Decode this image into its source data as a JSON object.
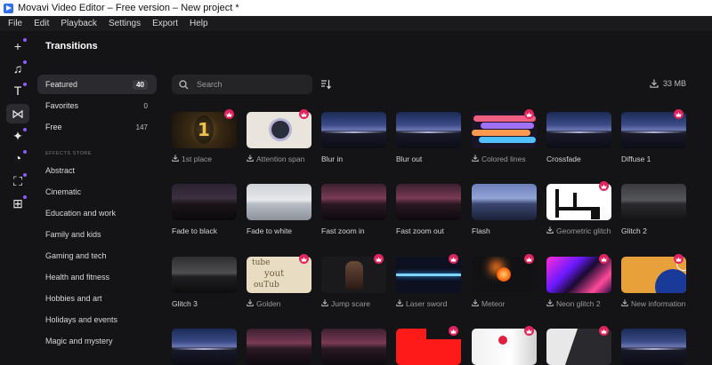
{
  "window": {
    "title": "Movavi Video Editor – Free version – New project *"
  },
  "menu": [
    "File",
    "Edit",
    "Playback",
    "Settings",
    "Export",
    "Help"
  ],
  "tools": [
    {
      "icon": "plus-icon",
      "glyph": "+"
    },
    {
      "icon": "music-icon",
      "glyph": "♫"
    },
    {
      "icon": "text-icon",
      "glyph": "T"
    },
    {
      "icon": "transitions-icon",
      "glyph": "⋈"
    },
    {
      "icon": "sparkle-icon",
      "glyph": "✦"
    },
    {
      "icon": "sticker-icon",
      "glyph": "◔"
    },
    {
      "icon": "store-icon",
      "glyph": "⛶"
    },
    {
      "icon": "more-tools-icon",
      "glyph": "⊞"
    }
  ],
  "panel": {
    "title": "Transitions"
  },
  "categories": [
    {
      "label": "Featured",
      "count": "40",
      "selected": true
    },
    {
      "label": "Favorites",
      "count": "0",
      "selected": false
    },
    {
      "label": "Free",
      "count": "147",
      "selected": false
    }
  ],
  "store": {
    "label": "EFFECTS STORE",
    "items": [
      "Abstract",
      "Cinematic",
      "Education and work",
      "Family and kids",
      "Gaming and tech",
      "Health and fitness",
      "Hobbies and art",
      "Holidays and events",
      "Magic and mystery"
    ]
  },
  "search": {
    "placeholder": "Search"
  },
  "storage": {
    "size": "33 MB"
  },
  "tiles": [
    {
      "label": "1st place",
      "download": true,
      "premium": true,
      "thumb": "place"
    },
    {
      "label": "Attention span",
      "download": true,
      "premium": true,
      "thumb": "attn"
    },
    {
      "label": "Blur in",
      "download": false,
      "premium": false,
      "thumb": "bridge"
    },
    {
      "label": "Blur out",
      "download": false,
      "premium": false,
      "thumb": "bridge"
    },
    {
      "label": "Colored lines",
      "download": true,
      "premium": true,
      "thumb": "lines"
    },
    {
      "label": "Crossfade",
      "download": false,
      "premium": false,
      "thumb": "bridge"
    },
    {
      "label": "Diffuse 1",
      "download": false,
      "premium": true,
      "thumb": "bridge"
    },
    {
      "label": "Fade to black",
      "download": false,
      "premium": false,
      "thumb": "dark"
    },
    {
      "label": "Fade to white",
      "download": false,
      "premium": false,
      "thumb": "white"
    },
    {
      "label": "Fast zoom in",
      "download": false,
      "premium": false,
      "thumb": "pink"
    },
    {
      "label": "Fast zoom out",
      "download": false,
      "premium": false,
      "thumb": "pink"
    },
    {
      "label": "Flash",
      "download": false,
      "premium": false,
      "thumb": "flash"
    },
    {
      "label": "Geometric glitch",
      "download": true,
      "premium": true,
      "thumb": "geo"
    },
    {
      "label": "Glitch 2",
      "download": false,
      "premium": false,
      "thumb": "gray"
    },
    {
      "label": "Glitch 3",
      "download": false,
      "premium": false,
      "thumb": "bw"
    },
    {
      "label": "Golden",
      "download": true,
      "premium": true,
      "thumb": "golden"
    },
    {
      "label": "Jump scare",
      "download": true,
      "premium": true,
      "thumb": "jump"
    },
    {
      "label": "Laser sword",
      "download": true,
      "premium": true,
      "thumb": "laser"
    },
    {
      "label": "Meteor",
      "download": true,
      "premium": true,
      "thumb": "meteor"
    },
    {
      "label": "Neon glitch 2",
      "download": true,
      "premium": true,
      "thumb": "neon"
    },
    {
      "label": "New information",
      "download": true,
      "premium": true,
      "thumb": "newinfo"
    },
    {
      "label": "",
      "download": false,
      "premium": false,
      "thumb": "bridge"
    },
    {
      "label": "",
      "download": false,
      "premium": false,
      "thumb": "pink"
    },
    {
      "label": "",
      "download": false,
      "premium": false,
      "thumb": "pink"
    },
    {
      "label": "",
      "download": false,
      "premium": true,
      "thumb": "red"
    },
    {
      "label": "",
      "download": false,
      "premium": true,
      "thumb": "whitehalf"
    },
    {
      "label": "",
      "download": false,
      "premium": true,
      "thumb": "split"
    },
    {
      "label": "",
      "download": false,
      "premium": false,
      "thumb": "bridge"
    }
  ],
  "colors": {
    "accent": "#e0245e",
    "selection": "#2b2b2f",
    "background": "#141416"
  }
}
